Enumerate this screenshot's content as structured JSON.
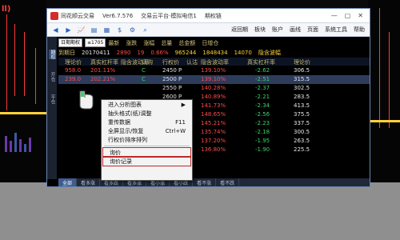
{
  "bg": {
    "label": "ll)",
    "colors": {
      "red": "#ff3b3b",
      "yellow": "#ffd23a"
    }
  },
  "window": {
    "title_parts": [
      "同花顺云交易",
      "Ver6.7.576",
      "交易云平台·模拟电信1",
      "期权链"
    ],
    "controls": [
      "—",
      "▢",
      "✕"
    ],
    "menu": [
      "返回期",
      "板块",
      "账户",
      "画线",
      "页面",
      "系统工具",
      "帮助"
    ]
  },
  "header": {
    "row1": {
      "select1": "日期期权",
      "select2": "≤1705",
      "labels": [
        "最新",
        "涨跌",
        "涨幅",
        "总量",
        "总金额",
        "日增仓"
      ],
      "values": {
        "last": "2890",
        "chg": "19",
        "pct": "0.66%",
        "vol": "965244",
        "amount": "1848434",
        "oi": "14070",
        "tail": "隐含波幅"
      }
    },
    "row2": {
      "label": "到期日",
      "value": "20170411"
    }
  },
  "columns": [
    "理论价",
    "真实杠杆率",
    "隐含波动率",
    "认购",
    "行权价",
    "认沽",
    "隐含波动率",
    "真实杠杆率",
    "理论价"
  ],
  "rows": [
    {
      "price": "958.0",
      "pct": "201.11%",
      "code": "C",
      "num": "2450",
      "p": "P",
      "v1": "139.10%",
      "v2": "-2.62",
      "v3": "306.5"
    },
    {
      "price": "239.0",
      "pct": "202.21%",
      "code": "C",
      "num": "2500",
      "p": "P",
      "v1": "139.10%",
      "v2": "-2.51",
      "v3": "315.5"
    },
    {
      "price": "",
      "pct": "",
      "code": "",
      "num": "2550",
      "p": "P",
      "v1": "140.28%",
      "v2": "-2.37",
      "v3": "302.5"
    },
    {
      "price": "",
      "pct": "",
      "code": "",
      "num": "2600",
      "p": "P",
      "v1": "140.89%",
      "v2": "-2.21",
      "v3": "283.5"
    },
    {
      "price": "",
      "pct": "",
      "code": "",
      "num": "2650",
      "p": "P",
      "v1": "141.73%",
      "v2": "-2.34",
      "v3": "413.5"
    },
    {
      "price": "",
      "pct": "",
      "code": "",
      "num": "2700",
      "p": "P",
      "v1": "148.65%",
      "v2": "-2.56",
      "v3": "375.5"
    },
    {
      "price": "",
      "pct": "",
      "code": "",
      "num": "2750",
      "p": "P",
      "v1": "145.21%",
      "v2": "-2.23",
      "v3": "337.5"
    },
    {
      "price": "",
      "pct": "",
      "code": "",
      "num": "2800",
      "p": "P",
      "v1": "135.74%",
      "v2": "-2.18",
      "v3": "300.5"
    },
    {
      "price": "",
      "pct": "",
      "code": "",
      "num": "2850",
      "p": "P",
      "v1": "137.20%",
      "v2": "-1.95",
      "v3": "263.5"
    },
    {
      "price": "",
      "pct": "",
      "code": "",
      "num": "2900",
      "p": "P",
      "v1": "136.80%",
      "v2": "-1.90",
      "v3": "225.5"
    }
  ],
  "sidebar": [
    "期权",
    "开仓",
    "平仓"
  ],
  "statusbar": [
    "全部",
    "看多涨",
    "看多跌",
    "看多涨",
    "看小涨",
    "看小跌",
    "看不涨",
    "看不跌"
  ],
  "context_menu": {
    "items": [
      {
        "label": "进入分析图表",
        "shortcut": "▶"
      },
      {
        "label": "抽头格式(纸)调整",
        "shortcut": ""
      },
      {
        "label": "重传数据",
        "shortcut": "F11"
      },
      {
        "label": "全屏显示/恢复",
        "shortcut": "Ctrl+W"
      },
      {
        "label": "行权价排序排列",
        "shortcut": ""
      },
      {
        "label": "询价",
        "shortcut": ""
      },
      {
        "label": "询价记录",
        "shortcut": ""
      }
    ]
  }
}
